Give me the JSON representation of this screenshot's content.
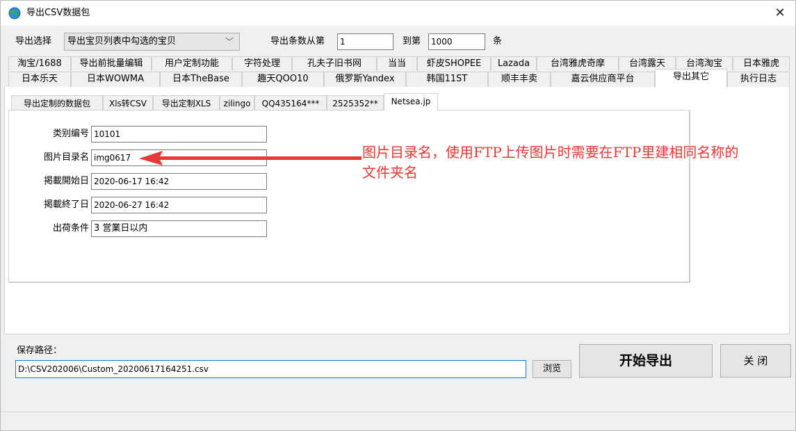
{
  "window": {
    "title": "导出CSV数据包",
    "close_glyph": "✕"
  },
  "export": {
    "select_label": "导出选择",
    "select_value": "导出宝贝列表中勾选的宝贝",
    "range_from_label": "导出条数从第",
    "range_from": "1",
    "range_to_label": "到第",
    "range_to": "1000",
    "range_unit": "条"
  },
  "tabs_row1": [
    "淘宝/1688",
    "导出前批量编辑",
    "用户定制功能",
    "字符处理",
    "孔夫子旧书网",
    "当当",
    "虾皮SHOPEE",
    "Lazada",
    "台湾雅虎奇摩",
    "台湾露天",
    "台湾淘宝",
    "日本雅虎"
  ],
  "tabs_row2": [
    "日本乐天",
    "日本WOWMA",
    "日本TheBase",
    "趣天QOO10",
    "俄罗斯Yandex",
    "韩国11ST",
    "顺丰丰卖",
    "嘉云供应商平台",
    "导出其它",
    "执行日志"
  ],
  "subtabs": [
    "导出定制的数据包",
    "Xls转CSV",
    "导出定制XLS",
    "zilingo",
    "QQ435164***",
    "2525352**",
    "Netsea.jp"
  ],
  "form": {
    "category_label": "类别编号",
    "category_value": "10101",
    "image_dir_label": "图片目录名",
    "image_dir_value": "img0617",
    "start_label": "掲載開始日",
    "start_value": "2020-06-17 16:42",
    "end_label": "掲載終了日",
    "end_value": "2020-06-27 16:42",
    "ship_label": "出荷条件",
    "ship_value": "3 営業日以内"
  },
  "annotation": {
    "line1": "图片目录名，使用FTP上传图片时需要在FTP里建相同名称的",
    "line2": "文件夹名",
    "color": "#e53935"
  },
  "save": {
    "label": "保存路径：",
    "path": "D:\\CSV202006\\Custom_20200617164251.csv",
    "browse": "浏览",
    "start": "开始导出",
    "close": "关 闭"
  }
}
